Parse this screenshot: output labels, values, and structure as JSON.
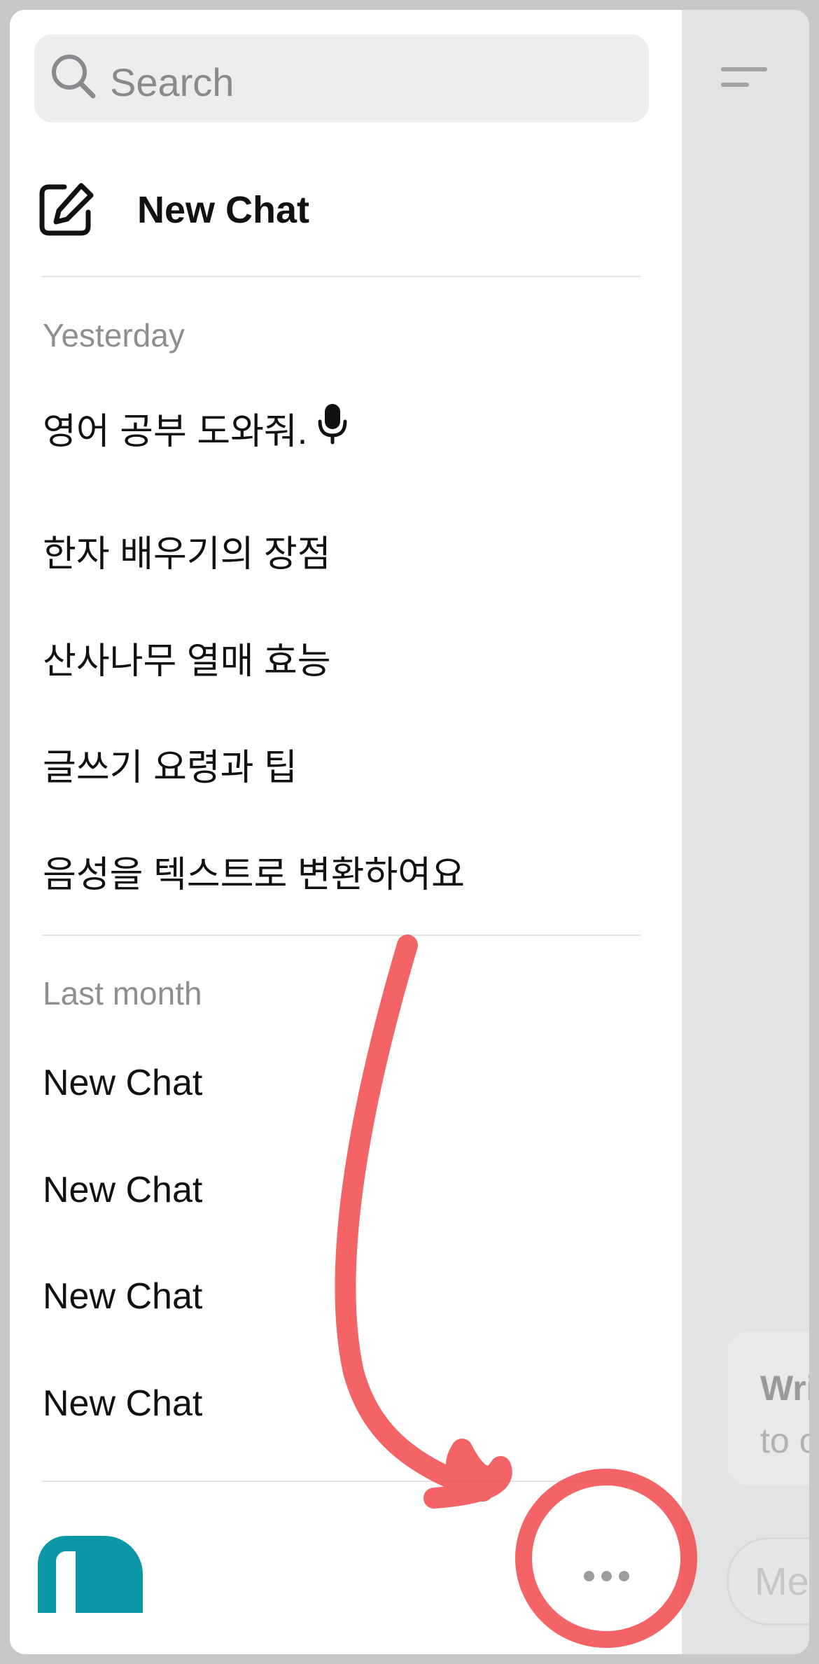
{
  "sidebar": {
    "search": {
      "placeholder": "Search",
      "icon": "search-icon"
    },
    "new_chat": {
      "label": "New Chat",
      "icon": "compose-icon"
    },
    "sections": [
      {
        "heading": "Yesterday",
        "items": [
          {
            "label": "영어 공부 도와줘.",
            "icon": "microphone-icon"
          },
          {
            "label": "한자 배우기의 장점"
          },
          {
            "label": "산사나무 열매 효능"
          },
          {
            "label": "글쓰기 요령과 팁"
          },
          {
            "label": "음성을 텍스트로 변환하여요"
          }
        ]
      },
      {
        "heading": "Last month",
        "items": [
          {
            "label": "New Chat"
          },
          {
            "label": "New Chat"
          },
          {
            "label": "New Chat"
          },
          {
            "label": "New Chat"
          }
        ]
      }
    ],
    "footer": {
      "avatar_color": "#0c97a6",
      "more_icon": "ellipsis-icon"
    }
  },
  "main": {
    "menu_icon": "menu-icon",
    "suggestion": {
      "title": "Writ",
      "subtitle": "to o"
    },
    "message_input": {
      "placeholder": "Mes"
    }
  },
  "annotation": {
    "color": "#f2484a",
    "shapes": [
      "arrow",
      "circle"
    ]
  }
}
